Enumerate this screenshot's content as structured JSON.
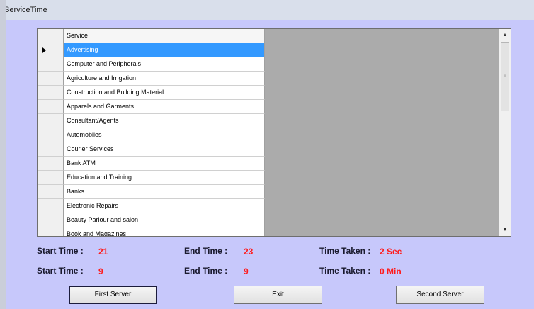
{
  "window": {
    "title": "ServiceTime"
  },
  "grid": {
    "column_header": "Service",
    "selected_index": 0,
    "rows": [
      "Advertising",
      "Computer and Peripherals",
      "Agriculture and Irrigation",
      "Construction and Building Material",
      "Apparels and Garments",
      "Consultant/Agents",
      "Automobiles",
      "Courier Services",
      "Bank ATM",
      "Education and Training",
      "Banks",
      "Electronic Repairs",
      "Beauty Parlour and salon",
      "Book and Magazines"
    ]
  },
  "stats": {
    "row1": {
      "start_label": "Start Time :",
      "start_value": "21",
      "end_label": "End Time :",
      "end_value": "23",
      "taken_label": "Time Taken :",
      "taken_value": "2 Sec"
    },
    "row2": {
      "start_label": "Start Time :",
      "start_value": "9",
      "end_label": "End Time :",
      "end_value": "9",
      "taken_label": "Time Taken :",
      "taken_value": "0 Min"
    }
  },
  "buttons": {
    "first_server": "First Server",
    "exit": "Exit",
    "second_server": "Second Server"
  }
}
